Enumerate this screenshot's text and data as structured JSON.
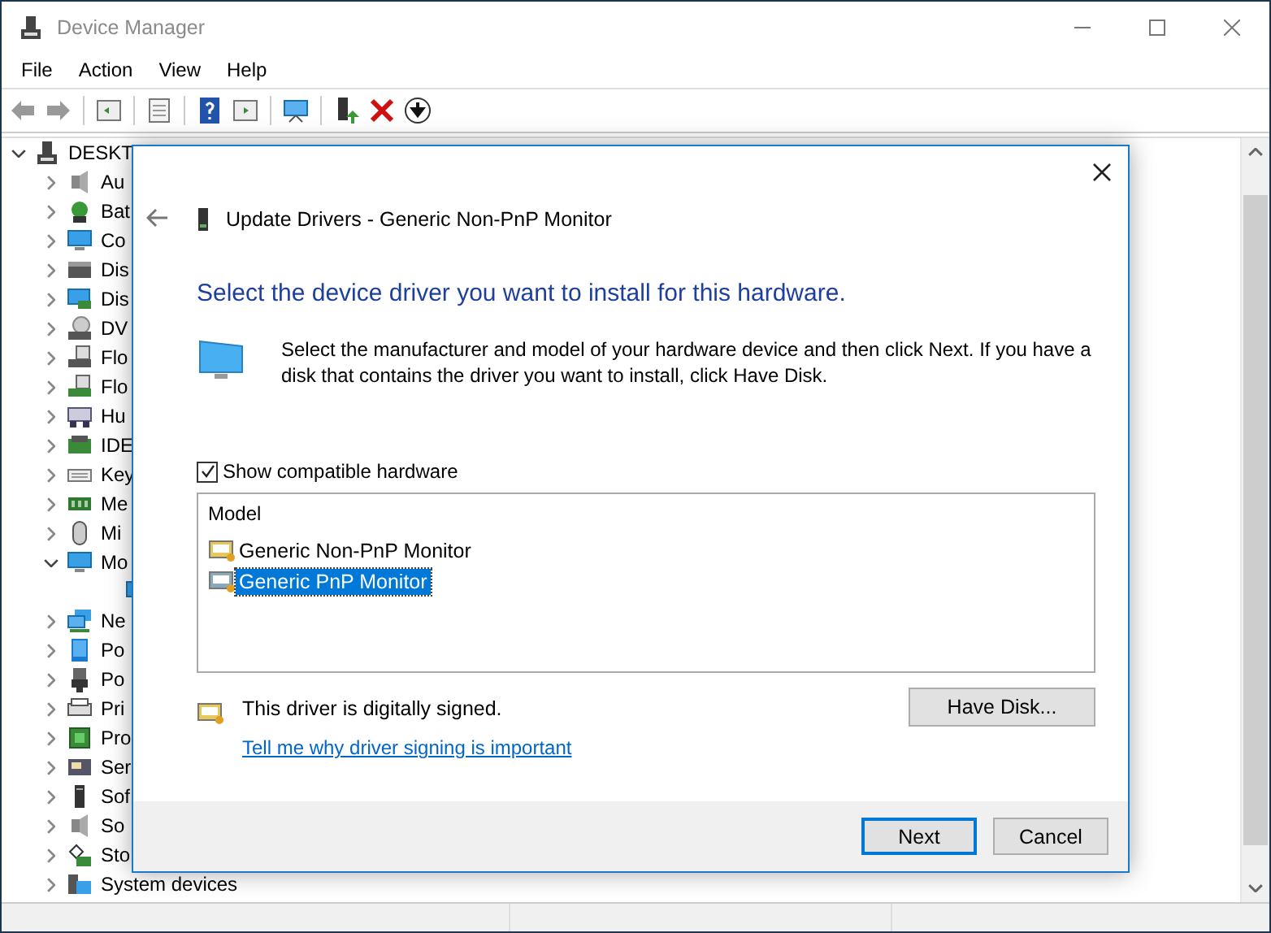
{
  "window": {
    "title": "Device Manager"
  },
  "menu": [
    "File",
    "Action",
    "View",
    "Help"
  ],
  "tree": [
    {
      "label": "DESKT",
      "expanded": true,
      "children": [
        {
          "label": "Au",
          "expanded": false
        },
        {
          "label": "Bat",
          "expanded": false
        },
        {
          "label": "Co",
          "expanded": false
        },
        {
          "label": "Dis",
          "expanded": false
        },
        {
          "label": "Dis",
          "expanded": false
        },
        {
          "label": "DV",
          "expanded": false
        },
        {
          "label": "Flo",
          "expanded": false
        },
        {
          "label": "Flo",
          "expanded": false
        },
        {
          "label": "Hu",
          "expanded": false
        },
        {
          "label": "IDE",
          "expanded": false
        },
        {
          "label": "Key",
          "expanded": false
        },
        {
          "label": "Me",
          "expanded": false
        },
        {
          "label": "Mi",
          "expanded": false
        },
        {
          "label": "Mo",
          "expanded": true,
          "children": [
            {
              "kind": "device"
            }
          ]
        },
        {
          "label": "Ne",
          "expanded": false
        },
        {
          "label": "Po",
          "expanded": false
        },
        {
          "label": "Po",
          "expanded": false
        },
        {
          "label": "Pri",
          "expanded": false
        },
        {
          "label": "Pro",
          "expanded": false
        },
        {
          "label": "Ser",
          "expanded": false
        },
        {
          "label": "Sof",
          "expanded": false
        },
        {
          "label": "So",
          "expanded": false
        },
        {
          "label": "Sto",
          "expanded": false
        },
        {
          "label": "System devices",
          "expanded": false
        }
      ]
    }
  ],
  "dialog": {
    "title": "Update Drivers - Generic Non-PnP Monitor",
    "heading": "Select the device driver you want to install for this hardware.",
    "description": "Select the manufacturer and model of your hardware device and then click Next. If you have a disk that contains the driver you want to install, click Have Disk.",
    "show_compatible": {
      "label": "Show compatible hardware",
      "checked": true
    },
    "model_list": {
      "header": "Model",
      "items": [
        {
          "label": "Generic Non-PnP Monitor",
          "selected": false
        },
        {
          "label": "Generic PnP Monitor",
          "selected": true
        }
      ]
    },
    "signed_text": "This driver is digitally signed.",
    "signing_link": "Tell me why driver signing is important",
    "have_disk_button": "Have Disk...",
    "buttons": [
      {
        "label": "Next",
        "kind": "default"
      },
      {
        "label": "Cancel",
        "kind": "normal"
      }
    ]
  }
}
